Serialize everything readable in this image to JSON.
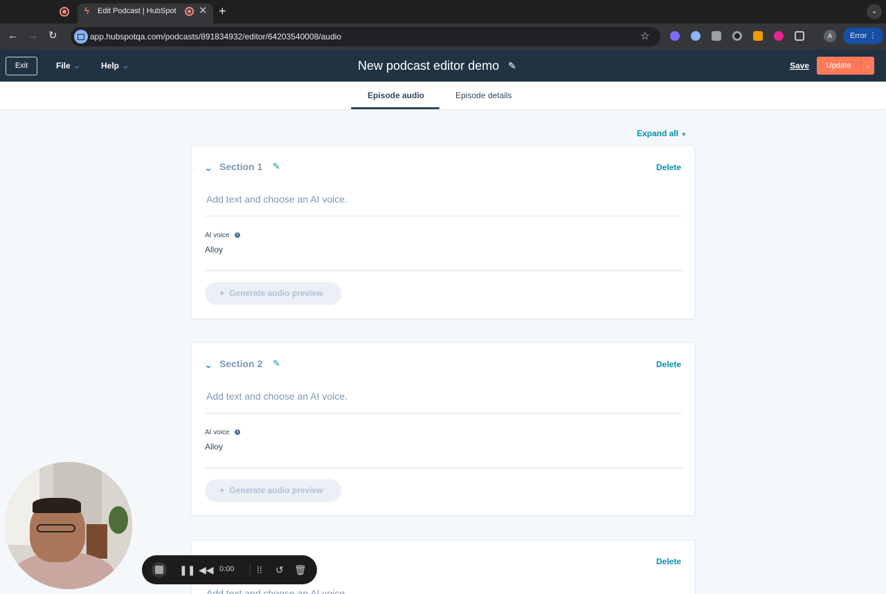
{
  "browser": {
    "tab_title": "Edit Podcast | HubSpot",
    "tab_close": "✕",
    "new_tab": "+",
    "url": "app.hubspotqa.com/podcasts/891834932/editor/64203540008/audio",
    "profile_initial": "A",
    "error_label": "Error",
    "nav_back": "←",
    "nav_forward": "→",
    "nav_reload": "↻",
    "star": "☆"
  },
  "header": {
    "exit_label": "Exit",
    "file_label": "File",
    "help_label": "Help",
    "title": "New podcast editor demo",
    "save_label": "Save",
    "update_label": "Update"
  },
  "tabs": [
    {
      "label": "Episode audio"
    },
    {
      "label": "Episode details"
    }
  ],
  "expand_all_label": "Expand all",
  "sections": [
    {
      "title": "Section 1",
      "delete_label": "Delete",
      "placeholder": "Add text and choose an AI voice.",
      "voice_label": "AI voice",
      "voice_value": "Alloy",
      "generate_label": "Generate audio preview"
    },
    {
      "title": "Section 2",
      "delete_label": "Delete",
      "placeholder": "Add text and choose an AI voice.",
      "voice_label": "AI voice",
      "voice_value": "Alloy",
      "generate_label": "Generate audio preview"
    },
    {
      "title": "",
      "delete_label": "Delete",
      "placeholder": "Add text and choose an AI voice."
    }
  ],
  "recorder": {
    "time": "0:00"
  },
  "colors": {
    "accent": "#0091ae",
    "header_bg": "#213343",
    "update_bg": "#ff7a59"
  }
}
